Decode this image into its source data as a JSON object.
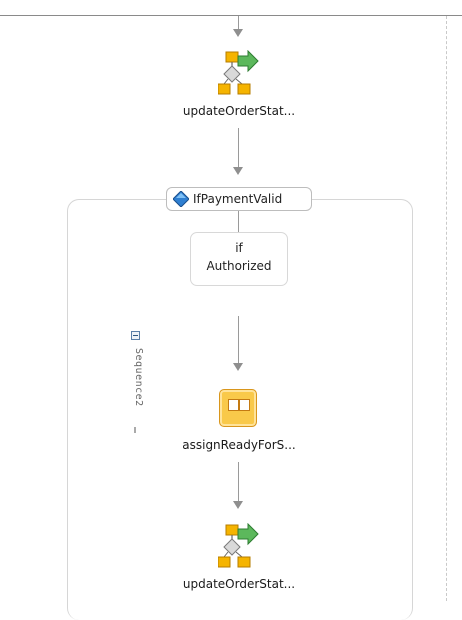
{
  "activities": {
    "invoke_top": {
      "label": "updateOrderStat...",
      "icon": "invoke-icon"
    },
    "switch": {
      "label": "IfPaymentValid",
      "icon": "switch-diamond-icon"
    },
    "case": {
      "label_line1": "if",
      "label_line2": "Authorized"
    },
    "sequence": {
      "label": "Sequence2"
    },
    "assign": {
      "label": "assignReadyForS...",
      "icon": "assign-icon"
    },
    "invoke_bottom": {
      "label": "updateOrderStat...",
      "icon": "invoke-icon"
    }
  },
  "colors": {
    "connector": "#9a9a9a",
    "invoke_boxes": "#f5b400",
    "invoke_arrow": "#5cb85c",
    "assign_fill": "#f9c94a",
    "switch_diamond": "#2f7fd1"
  }
}
